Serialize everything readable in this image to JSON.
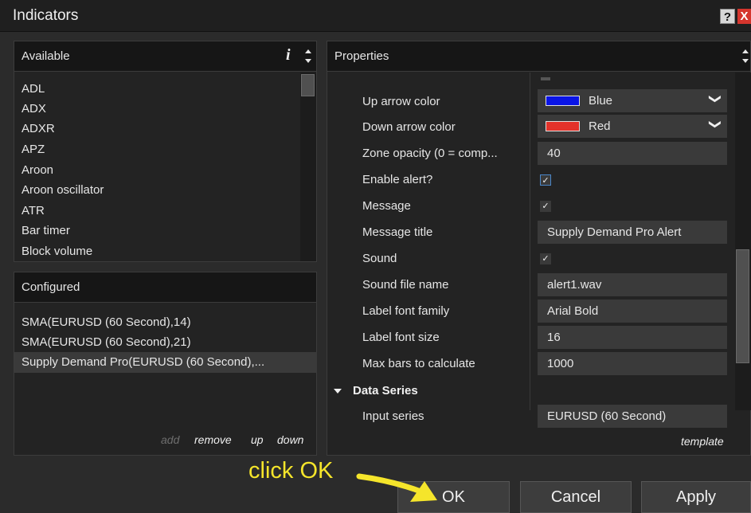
{
  "window": {
    "title": "Indicators",
    "help_label": "?",
    "close_label": "X"
  },
  "available": {
    "header": "Available",
    "info_label": "i",
    "items": [
      "ADL",
      "ADX",
      "ADXR",
      "APZ",
      "Aroon",
      "Aroon oscillator",
      "ATR",
      "Bar timer",
      "Block volume"
    ]
  },
  "configured": {
    "header": "Configured",
    "items": [
      "SMA(EURUSD (60 Second),14)",
      "SMA(EURUSD (60 Second),21)",
      "Supply Demand Pro(EURUSD (60 Second),..."
    ],
    "selected_index": 2,
    "links": {
      "add": "add",
      "remove": "remove",
      "up": "up",
      "down": "down"
    }
  },
  "properties": {
    "header": "Properties",
    "rows": {
      "up_arrow_color": {
        "label": "Up arrow color",
        "value": "Blue",
        "swatch": "#0a14e6"
      },
      "down_arrow_color": {
        "label": "Down arrow color",
        "value": "Red",
        "swatch": "#e3322a"
      },
      "zone_opacity": {
        "label": "Zone opacity (0 = comp...",
        "value": "40"
      },
      "enable_alert": {
        "label": "Enable alert?",
        "checked": true
      },
      "message": {
        "label": "Message",
        "checked": true
      },
      "message_title": {
        "label": "Message title",
        "value": "Supply Demand Pro Alert"
      },
      "sound": {
        "label": "Sound",
        "checked": true
      },
      "sound_file_name": {
        "label": "Sound file name",
        "value": "alert1.wav"
      },
      "label_font_family": {
        "label": "Label font family",
        "value": "Arial Bold"
      },
      "label_font_size": {
        "label": "Label font size",
        "value": "16"
      },
      "max_bars": {
        "label": "Max bars to calculate",
        "value": "1000"
      }
    },
    "category": "Data Series",
    "input_series": {
      "label": "Input series",
      "value": "EURUSD (60 Second)"
    },
    "template_link": "template"
  },
  "buttons": {
    "ok": "OK",
    "cancel": "Cancel",
    "apply": "Apply"
  },
  "annotation": {
    "text": "click OK",
    "color": "#f5e52b"
  },
  "icons": {
    "check": "✓",
    "chevron": "❯",
    "colors": {
      "accent_focus": "#4a86c8",
      "arrow": "#f5e52b"
    }
  }
}
